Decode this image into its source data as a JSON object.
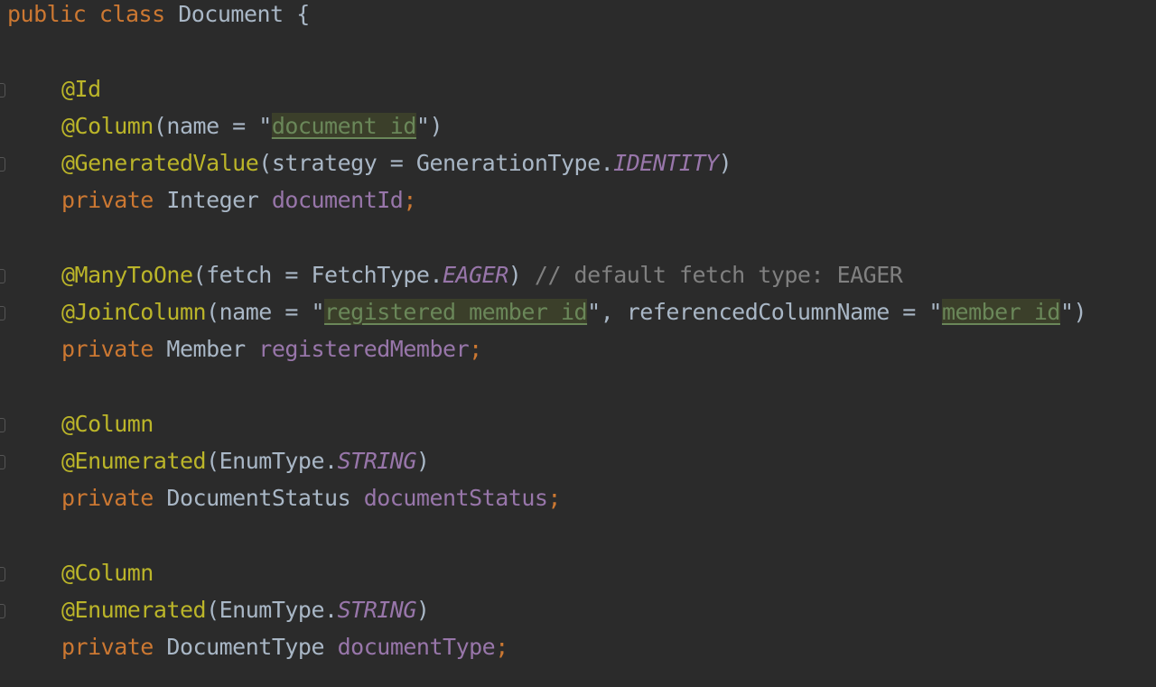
{
  "code": {
    "line01": {
      "kw1": "public",
      "kw2": "class",
      "name": "Document",
      "brace": "{"
    },
    "line03": {
      "ann": "@Id"
    },
    "line04": {
      "ann": "@Column",
      "p1": "(name = \"",
      "str": "document_id",
      "p2": "\")"
    },
    "line05": {
      "ann": "@GeneratedValue",
      "p1": "(strategy = GenerationType.",
      "const": "IDENTITY",
      "p2": ")"
    },
    "line06": {
      "kw": "private",
      "type": "Integer",
      "field": "documentId",
      "semi": ";"
    },
    "line08": {
      "ann": "@ManyToOne",
      "p1": "(fetch = FetchType.",
      "const": "EAGER",
      "p2": ")",
      "comment": "// default fetch type: EAGER"
    },
    "line09": {
      "ann": "@JoinColumn",
      "p1": "(name = \"",
      "str1": "registered_member_id",
      "p2": "\", referencedColumnName = \"",
      "str2": "member_id",
      "p3": "\")"
    },
    "line10": {
      "kw": "private",
      "type": "Member",
      "field": "registeredMember",
      "semi": ";"
    },
    "line12": {
      "ann": "@Column"
    },
    "line13": {
      "ann": "@Enumerated",
      "p1": "(EnumType.",
      "const": "STRING",
      "p2": ")"
    },
    "line14": {
      "kw": "private",
      "type": "DocumentStatus",
      "field": "documentStatus",
      "semi": ";"
    },
    "line16": {
      "ann": "@Column"
    },
    "line17": {
      "ann": "@Enumerated",
      "p1": "(EnumType.",
      "const": "STRING",
      "p2": ")"
    },
    "line18": {
      "kw": "private",
      "type": "DocumentType",
      "field": "documentType",
      "semi": ";"
    }
  },
  "theme": {
    "background": "#2b2b2b",
    "keyword": "#cc7832",
    "annotation": "#bbb529",
    "field": "#9876aa",
    "string": "#6a8759",
    "comment": "#808080",
    "text": "#a9b7c6"
  }
}
